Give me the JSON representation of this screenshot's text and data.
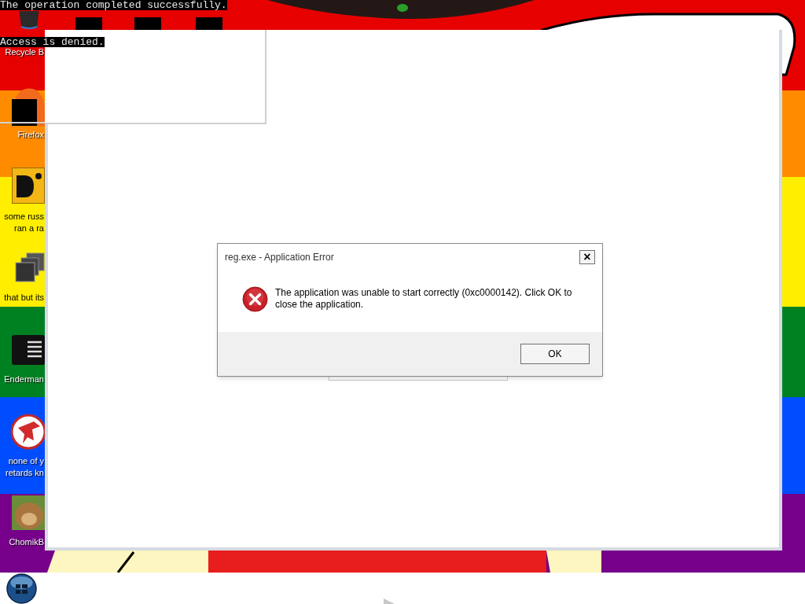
{
  "console_lines": [
    "The operation completed successfully.",
    "Access is denied."
  ],
  "desktop_icons": [
    {
      "kind": "recycle",
      "label_lines": [
        "Recycle B"
      ]
    },
    {
      "kind": "browser",
      "label_lines": [
        "Firefox"
      ]
    },
    {
      "kind": "letters",
      "label_lines": [
        "some russ",
        "ran a ra"
      ]
    },
    {
      "kind": "stack",
      "label_lines": [
        "that but its"
      ]
    },
    {
      "kind": "list",
      "label_lines": [
        "Enderman"
      ]
    },
    {
      "kind": "dino",
      "label_lines": [
        "none of y",
        "retards kn"
      ]
    },
    {
      "kind": "hamster",
      "label_lines": [
        "ChomikB"
      ]
    }
  ],
  "dialog": {
    "title": "reg.exe - Application Error",
    "close": "×",
    "message": "The application was unable to start correctly (0xc0000142). Click OK to close the application.",
    "buttons": [
      "OK"
    ]
  }
}
